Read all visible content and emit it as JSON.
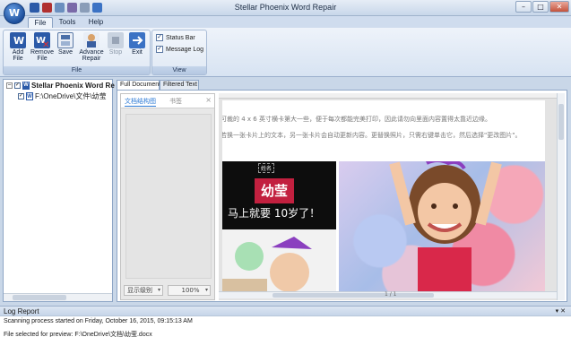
{
  "window": {
    "title": "Stellar Phoenix Word Repair",
    "app_icon_letter": "W",
    "controls": [
      "–",
      "□",
      "✕"
    ]
  },
  "ribbon": {
    "tabs": [
      "File",
      "Tools",
      "Help"
    ],
    "active_tab": "File",
    "file_group": {
      "label": "File",
      "buttons": [
        {
          "label": "Add\nFile",
          "icon": "add-file-icon"
        },
        {
          "label": "Remove\nFile",
          "icon": "remove-file-icon"
        },
        {
          "label": "Save",
          "icon": "save-icon"
        },
        {
          "label": "Advance\nRepair",
          "icon": "advance-repair-icon"
        },
        {
          "label": "Stop",
          "icon": "stop-icon",
          "disabled": true
        },
        {
          "label": "Exit",
          "icon": "exit-icon"
        }
      ]
    },
    "view_group": {
      "label": "View",
      "options": [
        {
          "label": "Status Bar",
          "checked": true
        },
        {
          "label": "Message Log",
          "checked": true
        }
      ]
    }
  },
  "tree": {
    "root": "Stellar Phoenix Word Re",
    "child": "F:\\OneDrive\\文件\\幼莹"
  },
  "doc_tabs": [
    "Full Document",
    "Filtered Text"
  ],
  "viewer": {
    "nav_tabs": [
      "文档结构图",
      "书签"
    ],
    "nav_close": "×",
    "nav_select": "显示级别",
    "zoom": "100%",
    "page_text_lines": [
      "可裁的 4 x 6 英寸横卡第大一些，便于每次都能完美打印，因此请勿向里面内容置得太靠近边缘。",
      "若换一张卡片上的文本，另一张卡片会自动更新内容。更替换照片，只需右键单击它，然后选择\"更改图片\"。"
    ],
    "card": {
      "name_label": "姓名",
      "name": "幼莹",
      "age_line": "马上就要 10岁了！"
    },
    "page_counter": "1 / 1"
  },
  "log": {
    "title": "Log Report",
    "pin": "▾ ✕",
    "lines": [
      "Scanning process started on Friday, October 16, 2015, 09:15:13 AM",
      "File selected for preview: F:\\OneDrive\\文档\\幼莹.docx"
    ]
  },
  "colors": {
    "accent": "#2b5aa8",
    "name_banner": "#c2203f",
    "ribbon_bg": "#dfe8f4"
  }
}
